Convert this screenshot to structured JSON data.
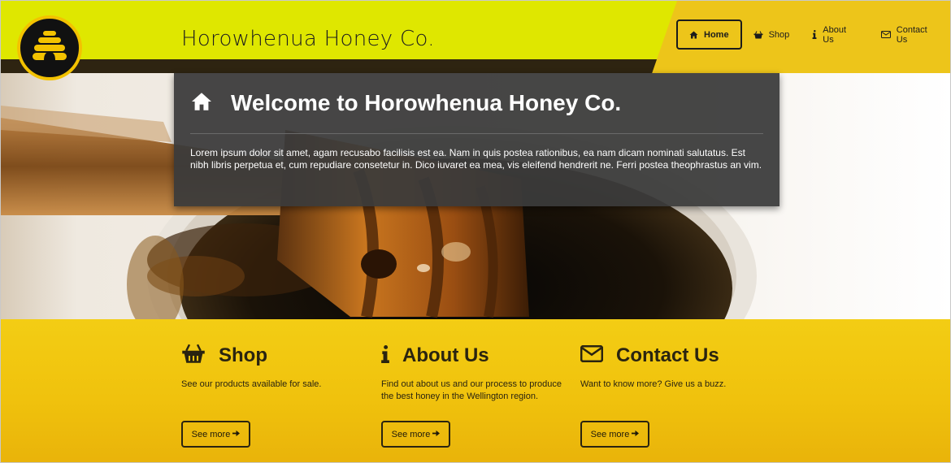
{
  "header": {
    "brand": "Horowhenua Honey Co.",
    "logo_icon": "beehive-icon"
  },
  "nav": {
    "items": [
      {
        "label": "Home",
        "icon": "home-icon",
        "active": true
      },
      {
        "label": "Shop",
        "icon": "basket-icon",
        "active": false
      },
      {
        "label": "About Us",
        "icon": "info-icon",
        "active": false
      },
      {
        "label": "Contact Us",
        "icon": "envelope-icon",
        "active": false
      }
    ]
  },
  "hero": {
    "title": "Welcome to Horowhenua Honey Co.",
    "text": "Lorem ipsum dolor sit amet, agam recusabo facilisis est ea. Nam in quis postea rationibus, ea nam dicam nominati salutatus. Est nibh libris perpetua et, cum repudiare consetetur in. Dico iuvaret ea mea, vis eleifend hendrerit ne. Ferri postea theophrastus an vim."
  },
  "features": [
    {
      "title": "Shop",
      "icon": "basket-icon",
      "text": "See our products available for sale.",
      "button": "See more"
    },
    {
      "title": "About Us",
      "icon": "info-icon",
      "text": "Find out about us and our process to produce the best honey in the Wellington region.",
      "button": "See more"
    },
    {
      "title": "Contact Us",
      "icon": "envelope-icon",
      "text": "Want to know more? Give us a buzz.",
      "button": "See more"
    }
  ],
  "colors": {
    "header_yellow": "#dfe700",
    "nav_gold": "#edc51a",
    "dark_band": "#2e2411",
    "section_gold": "#f0c20d"
  }
}
